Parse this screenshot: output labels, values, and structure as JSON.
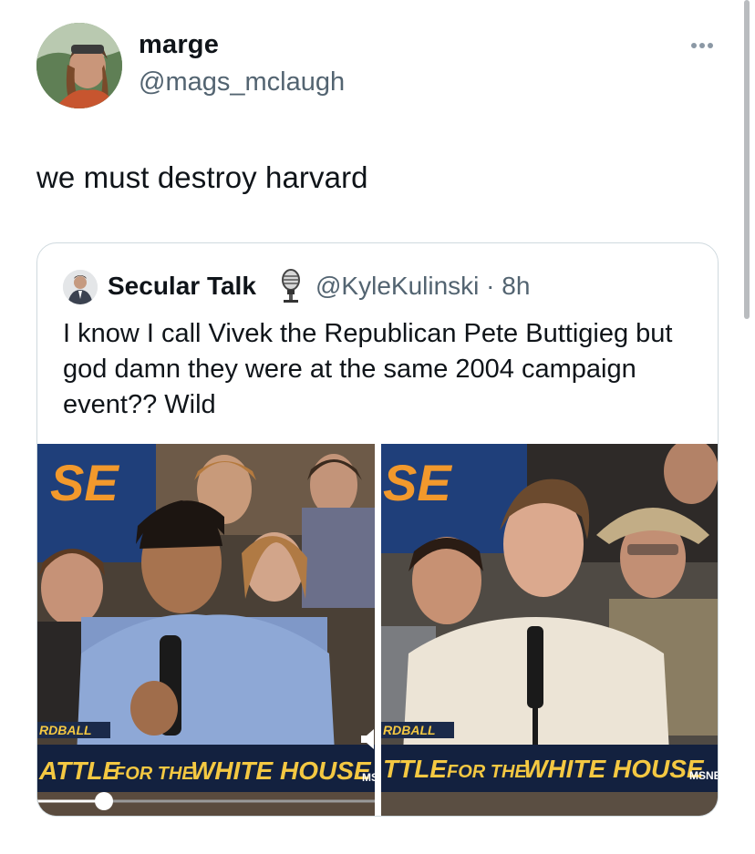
{
  "tweet": {
    "display_name": "marge",
    "handle": "@mags_mclaugh",
    "text": "we must destroy harvard",
    "avatar_icon": "profile-photo-avatar",
    "more_icon": "more-options-icon"
  },
  "quote": {
    "display_name": "Secular Talk",
    "badge_icon": "microphone-icon",
    "handle_time": "@KyleKulinski · 8h",
    "text": "I know I call Vivek the Republican Pete Buttigieg but god damn they were at the same 2004 campaign event?? Wild",
    "media": {
      "left": {
        "top_logo": "SE",
        "corner_tag": "RDBALL",
        "banner_prefix": "ATTLE",
        "banner_small": "FOR THE",
        "banner_main": "WHITE HOUSE",
        "network": "MSN"
      },
      "right": {
        "top_logo": "SE",
        "corner_tag": "RDBALL",
        "banner_prefix": "TTLE",
        "banner_small": "FOR THE",
        "banner_main": "WHITE HOUSE",
        "network": "MSNE"
      },
      "progress": 0.1
    }
  },
  "colors": {
    "text_primary": "#0f1419",
    "text_secondary": "#536471",
    "border": "#cfd9de",
    "banner_gold": "#f4c842",
    "logo_orange": "#f2992c"
  }
}
